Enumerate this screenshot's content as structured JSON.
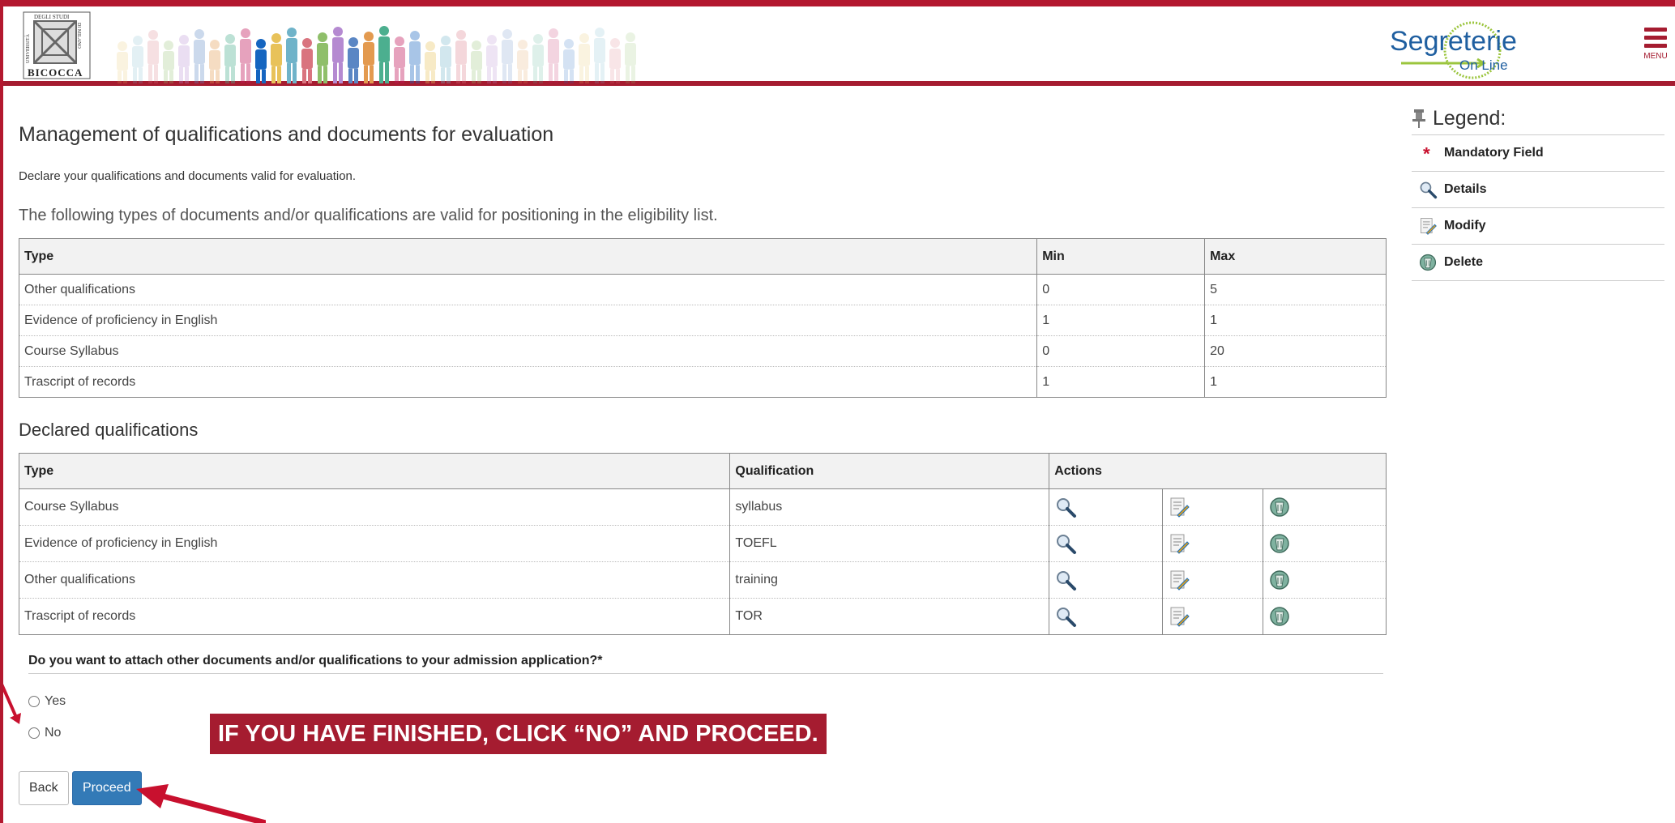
{
  "header": {
    "logo_lines": [
      "UNIVERSITÀ",
      "DEGLI STUDI",
      "DI MILANO",
      "BICOCCA"
    ],
    "brand_top": "Segreterie",
    "brand_bottom": "On Line",
    "menu_label": "MENU"
  },
  "page": {
    "title": "Management of qualifications and documents for evaluation",
    "subtitle": "Declare your qualifications and documents valid for evaluation.",
    "intro": "The following types of documents and/or qualifications are valid for positioning in the eligibility list."
  },
  "types_table": {
    "headers": [
      "Type",
      "Min",
      "Max"
    ],
    "rows": [
      {
        "type": "Other qualifications",
        "min": "0",
        "max": "5"
      },
      {
        "type": "Evidence of proficiency in English",
        "min": "1",
        "max": "1"
      },
      {
        "type": "Course Syllabus",
        "min": "0",
        "max": "20"
      },
      {
        "type": "Trascript of records",
        "min": "1",
        "max": "1"
      }
    ]
  },
  "declared": {
    "section_title": "Declared qualifications",
    "headers": [
      "Type",
      "Qualification",
      "Actions"
    ],
    "rows": [
      {
        "type": "Course Syllabus",
        "qualification": "syllabus"
      },
      {
        "type": "Evidence of proficiency in English",
        "qualification": "TOEFL"
      },
      {
        "type": "Other qualifications",
        "qualification": "training"
      },
      {
        "type": "Trascript of records",
        "qualification": "TOR"
      }
    ],
    "action_icons": [
      "magnifier-icon",
      "edit-icon",
      "delete-icon"
    ]
  },
  "question": {
    "text": "Do you want to attach other documents and/or qualifications to your admission application?*",
    "options": [
      "Yes",
      "No"
    ]
  },
  "banner": "IF YOU HAVE FINISHED, CLICK “NO” AND PROCEED.",
  "buttons": {
    "back": "Back",
    "proceed": "Proceed"
  },
  "legend": {
    "title": "Legend:",
    "items": [
      {
        "icon": "asterisk-icon",
        "label": "Mandatory Field"
      },
      {
        "icon": "magnifier-icon",
        "label": "Details"
      },
      {
        "icon": "edit-icon",
        "label": "Modify"
      },
      {
        "icon": "delete-icon",
        "label": "Delete"
      }
    ]
  },
  "colors": {
    "brand": "#a51c30",
    "primary_button": "#337ab7",
    "header_bg": "#f2f2f2"
  }
}
